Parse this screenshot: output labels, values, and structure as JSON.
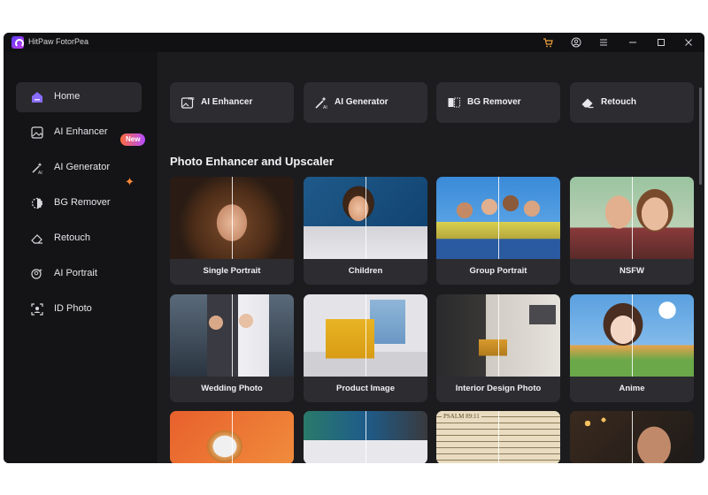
{
  "app": {
    "title": "HitPaw FotorPea"
  },
  "titlebar": {
    "icons": [
      "cart-icon",
      "account-icon",
      "menu-icon",
      "minimize-icon",
      "maximize-icon",
      "close-icon"
    ]
  },
  "sidebar": {
    "items": [
      {
        "label": "Home",
        "icon": "home-icon",
        "active": true
      },
      {
        "label": "AI Enhancer",
        "icon": "enhancer-icon",
        "badge": "New"
      },
      {
        "label": "AI Generator",
        "icon": "magic-wand-icon"
      },
      {
        "label": "BG Remover",
        "icon": "bg-remover-icon"
      },
      {
        "label": "Retouch",
        "icon": "eraser-icon"
      },
      {
        "label": "AI Portrait",
        "icon": "portrait-icon"
      },
      {
        "label": "ID Photo",
        "icon": "id-photo-icon"
      }
    ]
  },
  "tools": [
    {
      "label": "AI Enhancer",
      "icon": "hd-image-icon"
    },
    {
      "label": "AI Generator",
      "icon": "magic-wand-icon"
    },
    {
      "label": "BG Remover",
      "icon": "bg-remover-icon"
    },
    {
      "label": "Retouch",
      "icon": "eraser-icon"
    }
  ],
  "section": {
    "title": "Photo Enhancer and Upscaler"
  },
  "cards": [
    {
      "label": "Single Portrait"
    },
    {
      "label": "Children"
    },
    {
      "label": "Group Portrait"
    },
    {
      "label": "NSFW"
    },
    {
      "label": "Wedding Photo"
    },
    {
      "label": "Product Image"
    },
    {
      "label": "Interior Design Photo"
    },
    {
      "label": "Anime"
    }
  ],
  "partial_cards": {
    "book_text": "PSALM 89:11"
  },
  "colors": {
    "window_bg": "#1c1c1f",
    "sidebar_bg": "#141416",
    "button_bg": "#2c2c31",
    "accent_orange": "#ff8a3c",
    "accent_purple": "#b44cff"
  }
}
